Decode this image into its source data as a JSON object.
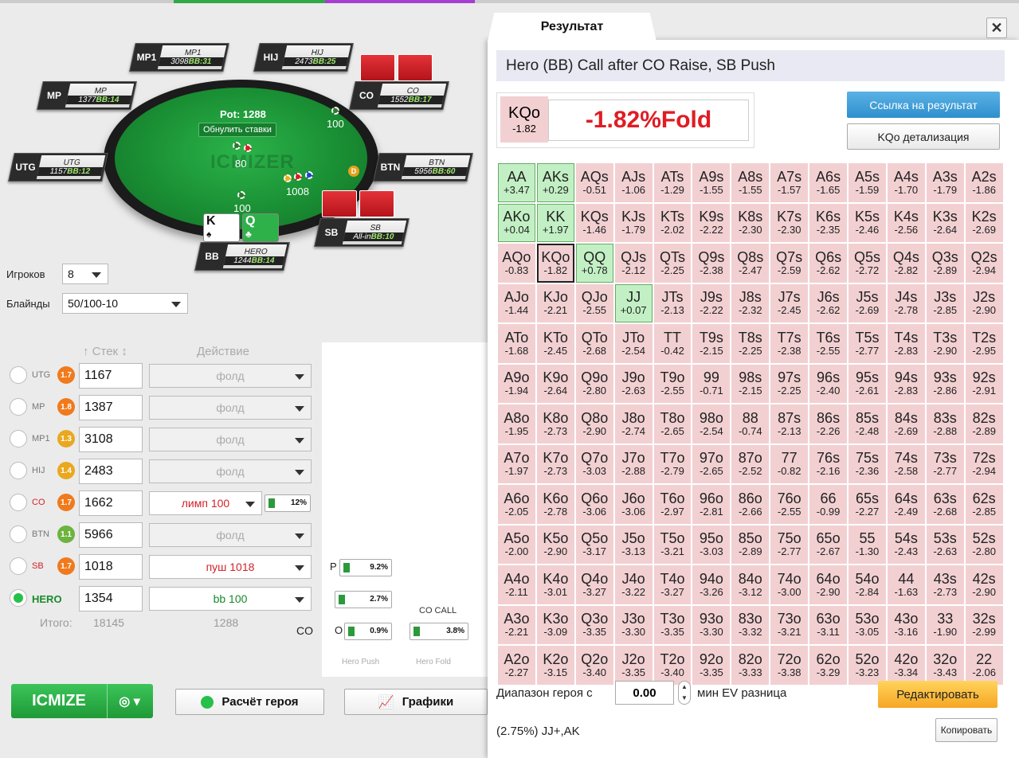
{
  "colors": {
    "accent_green": "#27c04a",
    "top_segments": [
      "#cccccc",
      "#2fa845",
      "#cccccc",
      "#a63fd0",
      "#cccccc"
    ]
  },
  "table": {
    "pot": "Pot: 1288",
    "reset_label": "Обнулить ставки",
    "watermark": "ICMIZER",
    "bets": {
      "co": "100",
      "sb": "1008",
      "bb": "100",
      "left": "80"
    },
    "seats": [
      {
        "pos": "MP1",
        "name": "MP1",
        "stack": "3098",
        "bb": "BB:31"
      },
      {
        "pos": "HIJ",
        "name": "HIJ",
        "stack": "2473",
        "bb": "BB:25"
      },
      {
        "pos": "MP",
        "name": "MP",
        "stack": "1377",
        "bb": "BB:14"
      },
      {
        "pos": "CO",
        "name": "CO",
        "stack": "1552",
        "bb": "BB:17"
      },
      {
        "pos": "UTG",
        "name": "UTG",
        "stack": "1157",
        "bb": "BB:12"
      },
      {
        "pos": "BTN",
        "name": "BTN",
        "stack": "5956",
        "bb": "BB:60"
      },
      {
        "pos": "SB",
        "name": "SB",
        "stack": "All-in",
        "bb": "BB:10"
      },
      {
        "pos": "BB",
        "name": "HERO",
        "stack": "1244",
        "bb": "BB:14"
      }
    ],
    "hero_cards": [
      "K",
      "Q"
    ],
    "dealer": "D"
  },
  "settings": {
    "players_label": "Игроков",
    "players_value": "8",
    "blinds_label": "Блайнды",
    "blinds_value": "50/100-10",
    "stack_header": "Стек",
    "action_header": "Действие"
  },
  "players": [
    {
      "pos": "UTG",
      "badge": "1.7",
      "badge_color": "#f07a1c",
      "stack": "1167",
      "action": "фолд",
      "action_color": "#aaaaaa",
      "selected": false
    },
    {
      "pos": "MP",
      "badge": "1.8",
      "badge_color": "#f07a1c",
      "stack": "1387",
      "action": "фолд",
      "action_color": "#aaaaaa",
      "selected": false
    },
    {
      "pos": "MP1",
      "badge": "1.3",
      "badge_color": "#e9a81f",
      "stack": "3108",
      "action": "фолд",
      "action_color": "#aaaaaa",
      "selected": false
    },
    {
      "pos": "HIJ",
      "badge": "1.4",
      "badge_color": "#e9a81f",
      "stack": "2483",
      "action": "фолд",
      "action_color": "#aaaaaa",
      "selected": false
    },
    {
      "pos": "CO",
      "badge": "1.7",
      "badge_color": "#f07a1c",
      "stack": "1662",
      "action": "лимп 100",
      "action_color": "#d3202a",
      "selected": false,
      "pct": "12%"
    },
    {
      "pos": "BTN",
      "badge": "1.1",
      "badge_color": "#6db33f",
      "stack": "5966",
      "action": "фолд",
      "action_color": "#aaaaaa",
      "selected": false
    },
    {
      "pos": "SB",
      "badge": "1.7",
      "badge_color": "#f07a1c",
      "stack": "1018",
      "action": "пуш 1018",
      "action_color": "#d3202a",
      "selected": false
    },
    {
      "pos": "HERO",
      "badge": "",
      "badge_color": "",
      "stack": "1354",
      "action": "bb 100",
      "action_color": "#1a8a2a",
      "selected": true
    }
  ],
  "totals": {
    "label": "Итого:",
    "stack": "18145",
    "action": "1288"
  },
  "mini_chart": {
    "p_label": "P",
    "p_value": "9.2%",
    "mid_value": "2.7%",
    "o_label": "O",
    "o_value": "0.9%",
    "co_label": "CO",
    "co_call_label": "CO CALL",
    "co_call_value": "3.8%",
    "hero_push": "Hero Push",
    "hero_fold": "Hero Fold"
  },
  "buttons": {
    "icmize": "ICMIZE",
    "hero_calc": "Расчёт героя",
    "charts": "Графики"
  },
  "result": {
    "tab_label": "Результат",
    "close": "✕",
    "header": "Hero (BB) Call after CO Raise, SB Push",
    "hand": "KQo",
    "hand_ev": "-1.82",
    "big_value": "-1.82%Fold",
    "link_button": "Ссылка на результат",
    "detail_button": "KQo детализация",
    "range_label": "Диапазон героя с",
    "min_ev_value": "0.00",
    "min_ev_label": "мин EV разница",
    "edit_button": "Редактировать",
    "range_result": "(2.75%) JJ+,AK",
    "copy_button": "Копировать"
  },
  "grid": [
    [
      [
        "AA",
        "+3.47"
      ],
      [
        "AKs",
        "+0.29"
      ],
      [
        "AQs",
        "-0.51"
      ],
      [
        "AJs",
        "-1.06"
      ],
      [
        "ATs",
        "-1.29"
      ],
      [
        "A9s",
        "-1.55"
      ],
      [
        "A8s",
        "-1.55"
      ],
      [
        "A7s",
        "-1.57"
      ],
      [
        "A6s",
        "-1.65"
      ],
      [
        "A5s",
        "-1.59"
      ],
      [
        "A4s",
        "-1.70"
      ],
      [
        "A3s",
        "-1.79"
      ],
      [
        "A2s",
        "-1.86"
      ]
    ],
    [
      [
        "AKo",
        "+0.04"
      ],
      [
        "KK",
        "+1.97"
      ],
      [
        "KQs",
        "-1.46"
      ],
      [
        "KJs",
        "-1.79"
      ],
      [
        "KTs",
        "-2.02"
      ],
      [
        "K9s",
        "-2.22"
      ],
      [
        "K8s",
        "-2.30"
      ],
      [
        "K7s",
        "-2.30"
      ],
      [
        "K6s",
        "-2.35"
      ],
      [
        "K5s",
        "-2.46"
      ],
      [
        "K4s",
        "-2.56"
      ],
      [
        "K3s",
        "-2.64"
      ],
      [
        "K2s",
        "-2.69"
      ]
    ],
    [
      [
        "AQo",
        "-0.83"
      ],
      [
        "KQo",
        "-1.82"
      ],
      [
        "QQ",
        "+0.78"
      ],
      [
        "QJs",
        "-2.12"
      ],
      [
        "QTs",
        "-2.25"
      ],
      [
        "Q9s",
        "-2.38"
      ],
      [
        "Q8s",
        "-2.47"
      ],
      [
        "Q7s",
        "-2.59"
      ],
      [
        "Q6s",
        "-2.62"
      ],
      [
        "Q5s",
        "-2.72"
      ],
      [
        "Q4s",
        "-2.82"
      ],
      [
        "Q3s",
        "-2.89"
      ],
      [
        "Q2s",
        "-2.94"
      ]
    ],
    [
      [
        "AJo",
        "-1.44"
      ],
      [
        "KJo",
        "-2.21"
      ],
      [
        "QJo",
        "-2.55"
      ],
      [
        "JJ",
        "+0.07"
      ],
      [
        "JTs",
        "-2.13"
      ],
      [
        "J9s",
        "-2.22"
      ],
      [
        "J8s",
        "-2.32"
      ],
      [
        "J7s",
        "-2.45"
      ],
      [
        "J6s",
        "-2.62"
      ],
      [
        "J5s",
        "-2.69"
      ],
      [
        "J4s",
        "-2.78"
      ],
      [
        "J3s",
        "-2.85"
      ],
      [
        "J2s",
        "-2.90"
      ]
    ],
    [
      [
        "ATo",
        "-1.68"
      ],
      [
        "KTo",
        "-2.45"
      ],
      [
        "QTo",
        "-2.68"
      ],
      [
        "JTo",
        "-2.54"
      ],
      [
        "TT",
        "-0.42"
      ],
      [
        "T9s",
        "-2.15"
      ],
      [
        "T8s",
        "-2.25"
      ],
      [
        "T7s",
        "-2.38"
      ],
      [
        "T6s",
        "-2.55"
      ],
      [
        "T5s",
        "-2.77"
      ],
      [
        "T4s",
        "-2.83"
      ],
      [
        "T3s",
        "-2.90"
      ],
      [
        "T2s",
        "-2.95"
      ]
    ],
    [
      [
        "A9o",
        "-1.94"
      ],
      [
        "K9o",
        "-2.64"
      ],
      [
        "Q9o",
        "-2.80"
      ],
      [
        "J9o",
        "-2.63"
      ],
      [
        "T9o",
        "-2.55"
      ],
      [
        "99",
        "-0.71"
      ],
      [
        "98s",
        "-2.15"
      ],
      [
        "97s",
        "-2.25"
      ],
      [
        "96s",
        "-2.40"
      ],
      [
        "95s",
        "-2.61"
      ],
      [
        "94s",
        "-2.83"
      ],
      [
        "93s",
        "-2.86"
      ],
      [
        "92s",
        "-2.91"
      ]
    ],
    [
      [
        "A8o",
        "-1.95"
      ],
      [
        "K8o",
        "-2.73"
      ],
      [
        "Q8o",
        "-2.90"
      ],
      [
        "J8o",
        "-2.74"
      ],
      [
        "T8o",
        "-2.65"
      ],
      [
        "98o",
        "-2.54"
      ],
      [
        "88",
        "-0.74"
      ],
      [
        "87s",
        "-2.13"
      ],
      [
        "86s",
        "-2.26"
      ],
      [
        "85s",
        "-2.48"
      ],
      [
        "84s",
        "-2.69"
      ],
      [
        "83s",
        "-2.88"
      ],
      [
        "82s",
        "-2.89"
      ]
    ],
    [
      [
        "A7o",
        "-1.97"
      ],
      [
        "K7o",
        "-2.73"
      ],
      [
        "Q7o",
        "-3.03"
      ],
      [
        "J7o",
        "-2.88"
      ],
      [
        "T7o",
        "-2.79"
      ],
      [
        "97o",
        "-2.65"
      ],
      [
        "87o",
        "-2.52"
      ],
      [
        "77",
        "-0.82"
      ],
      [
        "76s",
        "-2.16"
      ],
      [
        "75s",
        "-2.36"
      ],
      [
        "74s",
        "-2.58"
      ],
      [
        "73s",
        "-2.77"
      ],
      [
        "72s",
        "-2.94"
      ]
    ],
    [
      [
        "A6o",
        "-2.05"
      ],
      [
        "K6o",
        "-2.78"
      ],
      [
        "Q6o",
        "-3.06"
      ],
      [
        "J6o",
        "-3.06"
      ],
      [
        "T6o",
        "-2.97"
      ],
      [
        "96o",
        "-2.81"
      ],
      [
        "86o",
        "-2.66"
      ],
      [
        "76o",
        "-2.55"
      ],
      [
        "66",
        "-0.99"
      ],
      [
        "65s",
        "-2.27"
      ],
      [
        "64s",
        "-2.49"
      ],
      [
        "63s",
        "-2.68"
      ],
      [
        "62s",
        "-2.85"
      ]
    ],
    [
      [
        "A5o",
        "-2.00"
      ],
      [
        "K5o",
        "-2.90"
      ],
      [
        "Q5o",
        "-3.17"
      ],
      [
        "J5o",
        "-3.13"
      ],
      [
        "T5o",
        "-3.21"
      ],
      [
        "95o",
        "-3.03"
      ],
      [
        "85o",
        "-2.89"
      ],
      [
        "75o",
        "-2.77"
      ],
      [
        "65o",
        "-2.67"
      ],
      [
        "55",
        "-1.30"
      ],
      [
        "54s",
        "-2.43"
      ],
      [
        "53s",
        "-2.63"
      ],
      [
        "52s",
        "-2.80"
      ]
    ],
    [
      [
        "A4o",
        "-2.11"
      ],
      [
        "K4o",
        "-3.01"
      ],
      [
        "Q4o",
        "-3.27"
      ],
      [
        "J4o",
        "-3.22"
      ],
      [
        "T4o",
        "-3.27"
      ],
      [
        "94o",
        "-3.26"
      ],
      [
        "84o",
        "-3.12"
      ],
      [
        "74o",
        "-3.00"
      ],
      [
        "64o",
        "-2.90"
      ],
      [
        "54o",
        "-2.84"
      ],
      [
        "44",
        "-1.63"
      ],
      [
        "43s",
        "-2.73"
      ],
      [
        "42s",
        "-2.90"
      ]
    ],
    [
      [
        "A3o",
        "-2.21"
      ],
      [
        "K3o",
        "-3.09"
      ],
      [
        "Q3o",
        "-3.35"
      ],
      [
        "J3o",
        "-3.30"
      ],
      [
        "T3o",
        "-3.35"
      ],
      [
        "93o",
        "-3.30"
      ],
      [
        "83o",
        "-3.32"
      ],
      [
        "73o",
        "-3.21"
      ],
      [
        "63o",
        "-3.11"
      ],
      [
        "53o",
        "-3.05"
      ],
      [
        "43o",
        "-3.16"
      ],
      [
        "33",
        "-1.90"
      ],
      [
        "32s",
        "-2.99"
      ]
    ],
    [
      [
        "A2o",
        "-2.27"
      ],
      [
        "K2o",
        "-3.15"
      ],
      [
        "Q2o",
        "-3.40"
      ],
      [
        "J2o",
        "-3.35"
      ],
      [
        "T2o",
        "-3.40"
      ],
      [
        "92o",
        "-3.35"
      ],
      [
        "82o",
        "-3.33"
      ],
      [
        "72o",
        "-3.38"
      ],
      [
        "62o",
        "-3.29"
      ],
      [
        "52o",
        "-3.23"
      ],
      [
        "42o",
        "-3.34"
      ],
      [
        "32o",
        "-3.43"
      ],
      [
        "22",
        "-2.06"
      ]
    ]
  ]
}
